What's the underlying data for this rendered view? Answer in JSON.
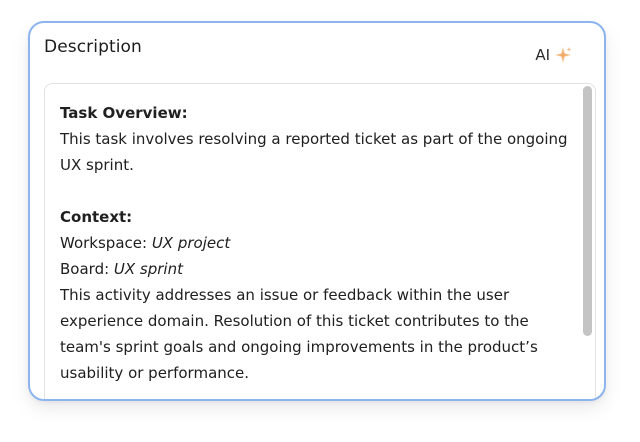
{
  "description_card": {
    "title": "Description",
    "ai_button": {
      "label": "AI",
      "icon": "sparkle-icon",
      "icon_color": "#f2b179"
    },
    "accent_border_color": "#8cb4ee",
    "body": {
      "task_overview_heading": "Task Overview:",
      "task_overview_text": "This task involves resolving a reported ticket as part of the ongoing UX sprint.",
      "context_heading": "Context:",
      "workspace_label": "Workspace: ",
      "workspace_value": "UX project",
      "board_label": "Board: ",
      "board_value": "UX sprint",
      "context_text": "This activity addresses an issue or feedback within the user experience domain. Resolution of this ticket contributes to the team's sprint goals and ongoing improvements in the product’s usability or performance."
    }
  }
}
